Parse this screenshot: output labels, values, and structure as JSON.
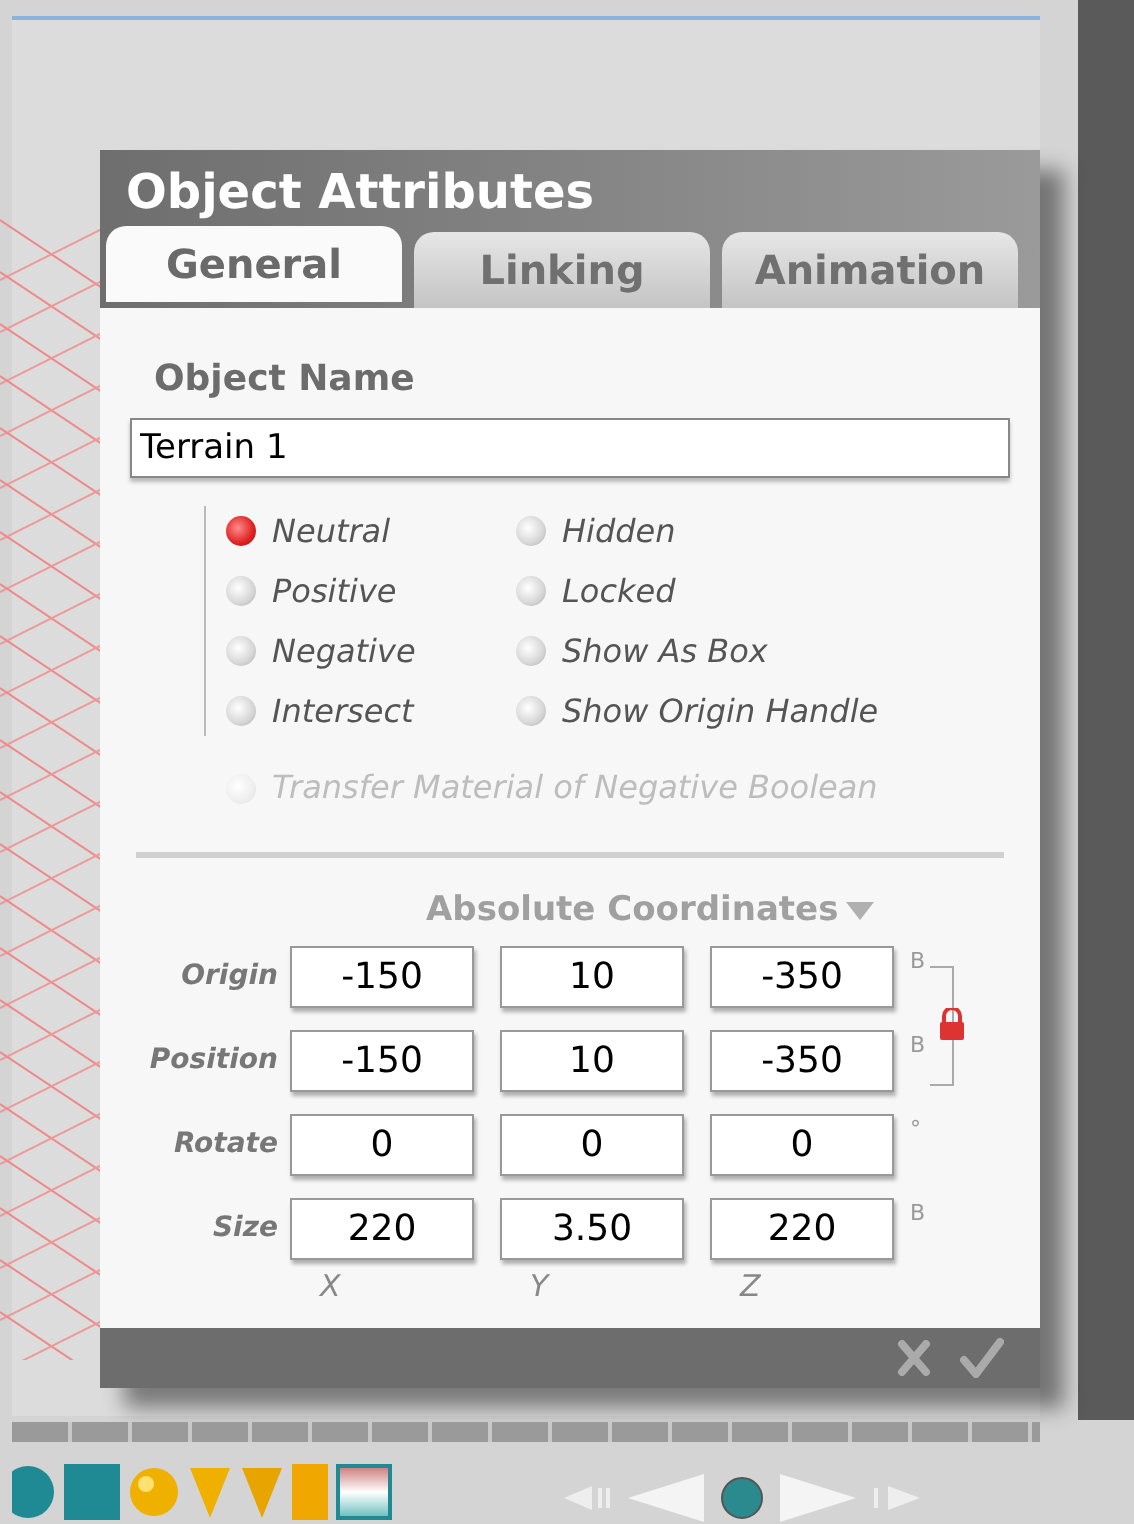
{
  "dialog": {
    "title": "Object Attributes",
    "tabs": [
      {
        "label": "General",
        "selected": true
      },
      {
        "label": "Linking",
        "selected": false
      },
      {
        "label": "Animation",
        "selected": false
      }
    ],
    "object_name": {
      "label": "Object Name",
      "value": "Terrain 1"
    },
    "boolean_options": [
      {
        "label": "Neutral",
        "selected": true
      },
      {
        "label": "Positive",
        "selected": false
      },
      {
        "label": "Negative",
        "selected": false
      },
      {
        "label": "Intersect",
        "selected": false
      }
    ],
    "display_options": [
      {
        "label": "Hidden",
        "checked": false
      },
      {
        "label": "Locked",
        "checked": false
      },
      {
        "label": "Show As Box",
        "checked": false
      },
      {
        "label": "Show Origin Handle",
        "checked": false
      }
    ],
    "transfer_option": {
      "label": "Transfer Material of Negative Boolean",
      "checked": false,
      "disabled": true
    },
    "coordinate_mode": "Absolute Coordinates",
    "rows": [
      {
        "label": "Origin",
        "values": [
          "-150",
          "10",
          "-350"
        ],
        "unit": "B"
      },
      {
        "label": "Position",
        "values": [
          "-150",
          "10",
          "-350"
        ],
        "unit": "B"
      },
      {
        "label": "Rotate",
        "values": [
          "0",
          "0",
          "0"
        ],
        "unit": "°"
      },
      {
        "label": "Size",
        "values": [
          "220",
          "3.50",
          "220"
        ],
        "unit": "B"
      }
    ],
    "axes": [
      "X",
      "Y",
      "Z"
    ],
    "origin_position_locked": true
  }
}
